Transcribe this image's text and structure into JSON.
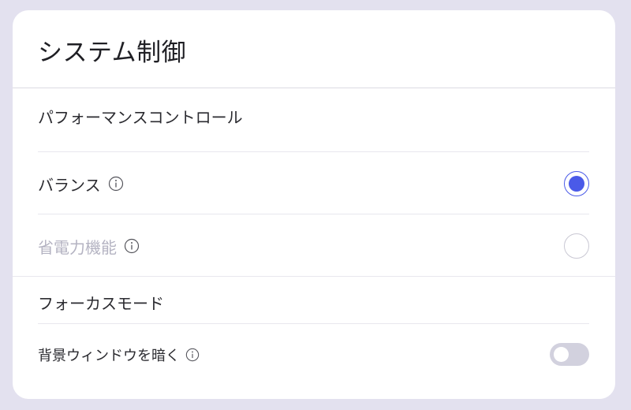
{
  "colors": {
    "accent": "#4a5ae8",
    "background": "#e3e1ef",
    "card": "#ffffff",
    "disabled_text": "#b4b3c2",
    "toggle_off": "#d2d1de"
  },
  "panel": {
    "title": "システム制御"
  },
  "performance": {
    "title": "パフォーマンスコントロール",
    "options": [
      {
        "label": "バランス",
        "selected": true,
        "disabled": false,
        "icon": "info-icon"
      },
      {
        "label": "省電力機能",
        "selected": false,
        "disabled": true,
        "icon": "info-icon"
      }
    ]
  },
  "focus": {
    "title": "フォーカスモード",
    "settings": [
      {
        "label": "背景ウィンドウを暗く",
        "enabled": false,
        "icon": "info-icon"
      }
    ]
  }
}
